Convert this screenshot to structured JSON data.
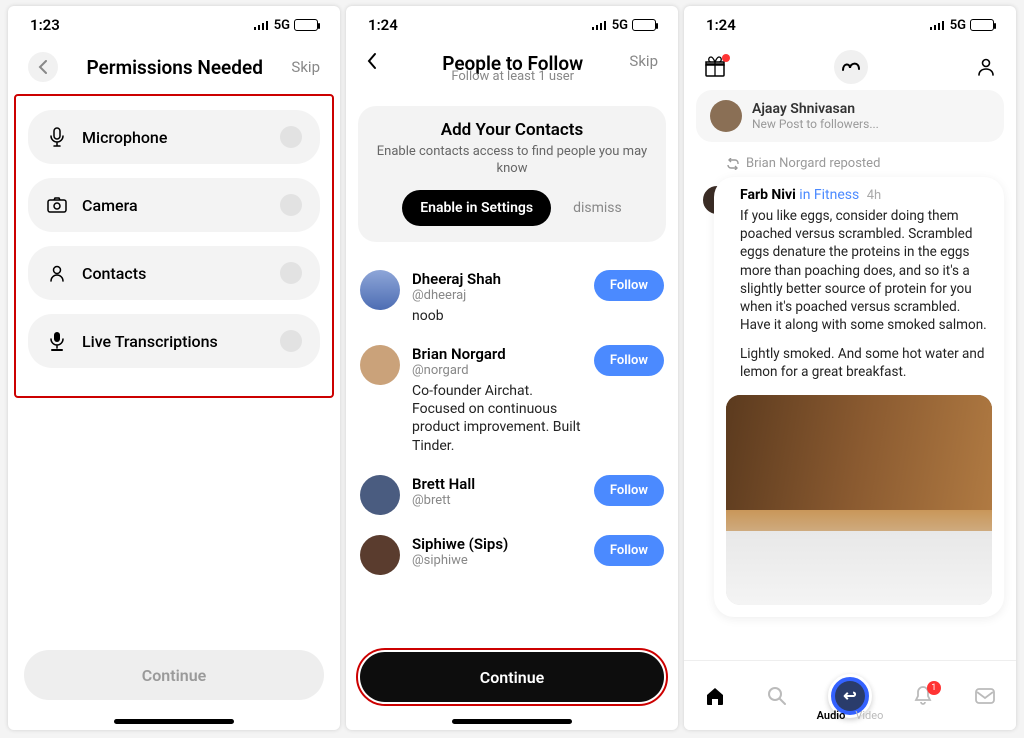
{
  "screen1": {
    "status": {
      "time": "1:23",
      "network": "5G"
    },
    "title": "Permissions Needed",
    "skip": "Skip",
    "items": [
      {
        "label": "Microphone",
        "icon": "microphone-icon"
      },
      {
        "label": "Camera",
        "icon": "camera-icon"
      },
      {
        "label": "Contacts",
        "icon": "contacts-icon"
      },
      {
        "label": "Live Transcriptions",
        "icon": "transcription-icon"
      }
    ],
    "continue": "Continue"
  },
  "screen2": {
    "status": {
      "time": "1:24",
      "network": "5G"
    },
    "title": "People to Follow",
    "subtitle": "Follow at least 1 user",
    "skip": "Skip",
    "contacts_card": {
      "title": "Add Your Contacts",
      "body": "Enable contacts access to find people you may know",
      "enable": "Enable in Settings",
      "dismiss": "dismiss"
    },
    "people": [
      {
        "name": "Dheeraj Shah",
        "handle": "@dheeraj",
        "bio": "noob",
        "follow": "Follow"
      },
      {
        "name": "Brian Norgard",
        "handle": "@norgard",
        "bio": "Co-founder Airchat. Focused on continuous product improvement. Built Tinder.",
        "follow": "Follow"
      },
      {
        "name": "Brett Hall",
        "handle": "@brett",
        "bio": "",
        "follow": "Follow"
      },
      {
        "name": "Siphiwe (Sips)",
        "handle": "@siphiwe",
        "bio": "",
        "follow": "Follow"
      }
    ],
    "continue": "Continue"
  },
  "screen3": {
    "status": {
      "time": "1:24",
      "network": "5G"
    },
    "prior": {
      "name": "Ajaay Shnivasan",
      "sub": "New Post to followers..."
    },
    "repost_label": "Brian Norgard reposted",
    "post": {
      "author": "Farb Nivi",
      "in_label": "in Fitness",
      "time": "4h",
      "p1": "If you like eggs, consider doing them poached versus scrambled. Scrambled eggs denature the proteins in the eggs more than poaching does, and so it's a slightly better source of protein for you when it's poached versus scrambled. Have it along with some smoked salmon.",
      "p2": "Lightly smoked. And some hot water and lemon for a great breakfast."
    },
    "notification_count": "1",
    "tabs": {
      "audio": "Audio",
      "video": "Video"
    }
  }
}
